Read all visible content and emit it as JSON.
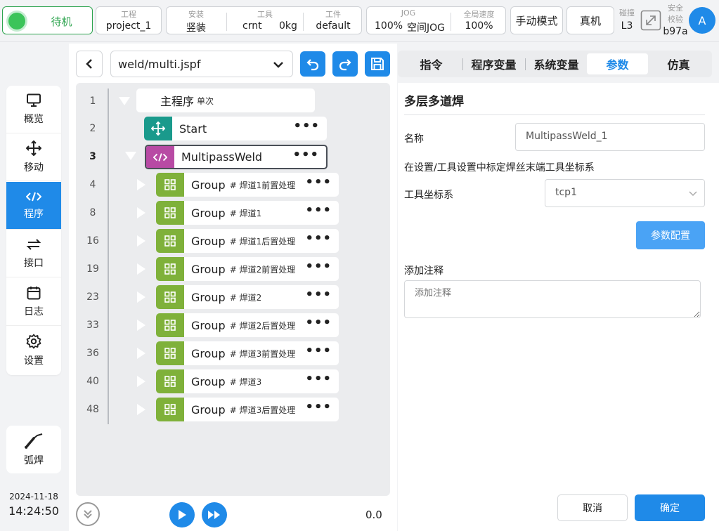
{
  "topbar": {
    "status_label": "待机",
    "project": {
      "caption": "工程",
      "value": "project_1"
    },
    "install": {
      "caption": "安装",
      "value": "竖装"
    },
    "tool": {
      "caption": "工具",
      "name": "crnt",
      "weight": "0kg"
    },
    "workpiece": {
      "caption": "工件",
      "value": "default"
    },
    "jog": {
      "caption": "JOG",
      "speed": "100%",
      "mode": "空间JOG"
    },
    "global_speed": {
      "caption": "全局速度",
      "value": "100%"
    },
    "manual_mode": "手动模式",
    "real_machine": "真机",
    "collision": {
      "caption": "碰撞",
      "value": "L3"
    },
    "safety": {
      "caption_1": "安全",
      "caption_2": "校验",
      "value": "b97a"
    },
    "avatar_letter": "A"
  },
  "sidebar": {
    "items": [
      {
        "label": "概览",
        "icon": "monitor-icon"
      },
      {
        "label": "移动",
        "icon": "move-icon"
      },
      {
        "label": "程序",
        "icon": "code-icon"
      },
      {
        "label": "接口",
        "icon": "interface-icon"
      },
      {
        "label": "日志",
        "icon": "calendar-icon"
      },
      {
        "label": "设置",
        "icon": "gear-icon"
      }
    ],
    "active_index": 2,
    "weld_label": "弧焊"
  },
  "datetime": {
    "date": "2024-11-18",
    "time": "14:24:50"
  },
  "file": {
    "path": "weld/multi.jspf"
  },
  "tree": {
    "main": {
      "line": "1",
      "label": "主程序",
      "mode": "单次"
    },
    "start": {
      "line": "2",
      "label": "Start"
    },
    "multipass": {
      "line": "3",
      "label": "MultipassWeld"
    },
    "groups": [
      {
        "line": "4",
        "label": "Group",
        "comment": "# 焊道1前置处理"
      },
      {
        "line": "8",
        "label": "Group",
        "comment": "# 焊道1"
      },
      {
        "line": "16",
        "label": "Group",
        "comment": "# 焊道1后置处理"
      },
      {
        "line": "19",
        "label": "Group",
        "comment": "# 焊道2前置处理"
      },
      {
        "line": "23",
        "label": "Group",
        "comment": "# 焊道2"
      },
      {
        "line": "33",
        "label": "Group",
        "comment": "# 焊道2后置处理"
      },
      {
        "line": "36",
        "label": "Group",
        "comment": "# 焊道3前置处理"
      },
      {
        "line": "40",
        "label": "Group",
        "comment": "# 焊道3"
      },
      {
        "line": "48",
        "label": "Group",
        "comment": "# 焊道3后置处理"
      }
    ],
    "more": "•••"
  },
  "player": {
    "value": "0.0"
  },
  "tabs": [
    "指令",
    "程序变量",
    "系统变量",
    "参数",
    "仿真"
  ],
  "active_tab": 3,
  "params": {
    "title": "多层多道焊",
    "name_label": "名称",
    "name_value": "MultipassWeld_1",
    "hint": "在设置/工具设置中标定焊丝末端工具坐标系",
    "tool_frame_label": "工具坐标系",
    "tool_frame_value": "tcp1",
    "config_button": "参数配置",
    "note_label": "添加注释",
    "note_placeholder": "添加注释"
  },
  "footer": {
    "cancel": "取消",
    "confirm": "确定"
  },
  "colors": {
    "accent": "#1f8ae8",
    "status_green": "#2ea44f",
    "group_green": "#7fb13a",
    "move_teal": "#1a9a8c",
    "weld_magenta": "#b84aa4"
  }
}
